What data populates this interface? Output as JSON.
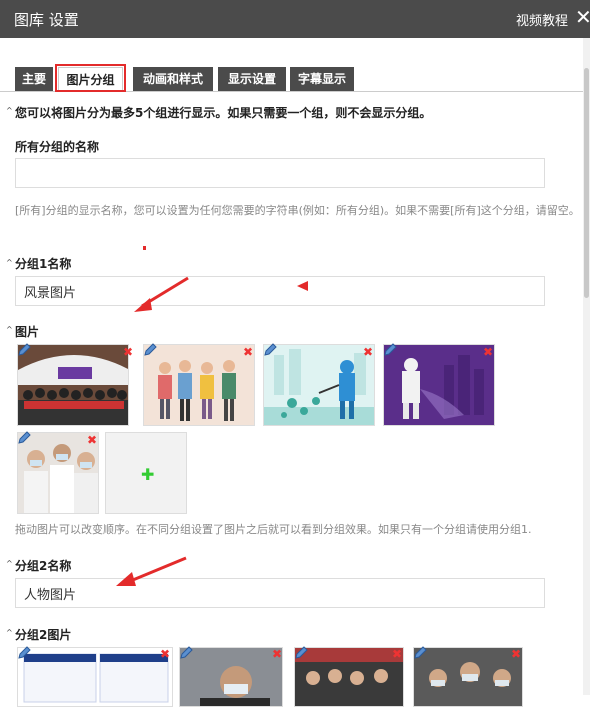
{
  "header": {
    "title": "图库 设置",
    "help_link": "视频教程",
    "close_icon": "close-icon"
  },
  "tabs": [
    {
      "label": "主要",
      "active": false
    },
    {
      "label": "图片分组",
      "active": true
    },
    {
      "label": "动画和样式",
      "active": false
    },
    {
      "label": "显示设置",
      "active": false
    },
    {
      "label": "字幕显示",
      "active": false
    }
  ],
  "intro": "您可以将图片分为最多5个组进行显示。如果只需要一个组，则不会显示分组。",
  "all_groups": {
    "label": "所有分组的名称",
    "value": "",
    "hint": "[所有]分组的显示名称，您可以设置为任何您需要的字符串(例如：所有分组)。如果不需要[所有]这个分组，请留空。"
  },
  "group1": {
    "name_label": "分组1名称",
    "name_value": "风景图片",
    "images_label": "图片",
    "drag_hint": "拖动图片可以改变顺序。在不同分组设置了图片之后就可以看到分组效果。如果只有一个分组请使用分组1."
  },
  "group2": {
    "name_label": "分组2名称",
    "name_value": "人物图片",
    "images_label": "分组2图片"
  },
  "colors": {
    "header_bg": "#4b4b4b",
    "highlight": "#e32b2b",
    "add_plus": "#33cc33",
    "delete": "#e33333"
  }
}
